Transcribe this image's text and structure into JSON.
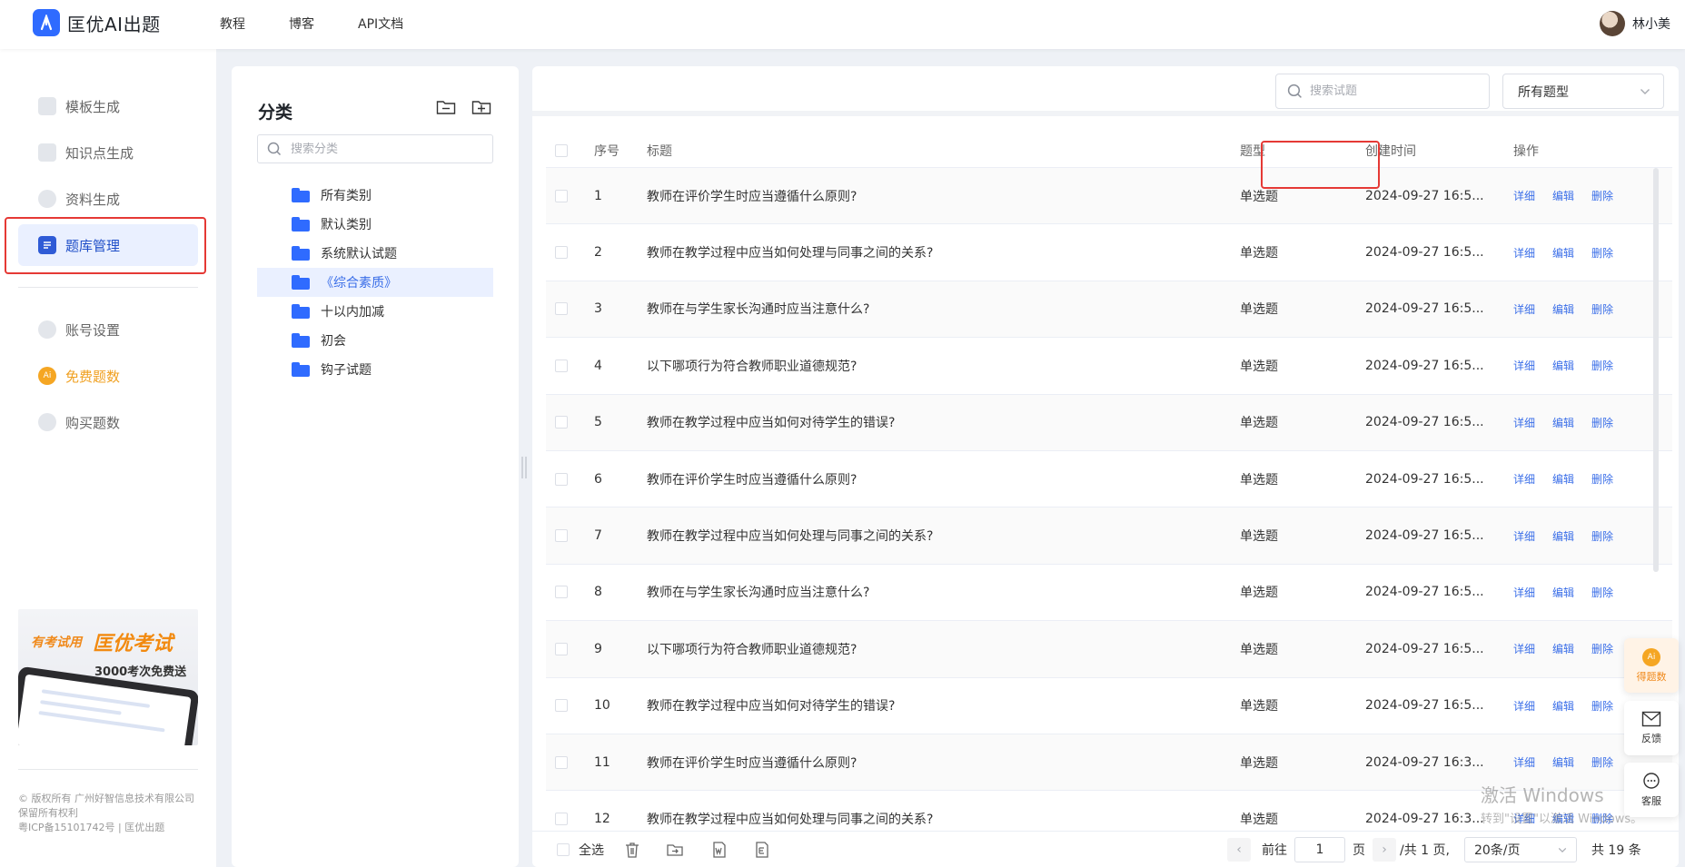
{
  "app": {
    "name": "匡优AI出题"
  },
  "topnav": [
    {
      "label": "教程"
    },
    {
      "label": "博客"
    },
    {
      "label": "API文档"
    }
  ],
  "user": {
    "name": "林小美"
  },
  "sidebar": {
    "items": [
      {
        "label": "模板生成"
      },
      {
        "label": "知识点生成"
      },
      {
        "label": "资料生成"
      },
      {
        "label": "题库管理"
      },
      {
        "label": "账号设置"
      },
      {
        "label": "免费题数"
      },
      {
        "label": "购买题数"
      }
    ],
    "free_icon_text": "Ai",
    "promo": {
      "tag": "有考试用",
      "brand": "匡优考试",
      "offer": "3000考次免费送"
    },
    "footer": {
      "line1": "© 版权所有 广州好智信息技术有限公司",
      "line2": "保留所有权利",
      "line3": "粤ICP备15101742号 | 匡优出题"
    }
  },
  "category": {
    "title": "分类",
    "search_placeholder": "搜索分类",
    "items": [
      {
        "label": "所有类别"
      },
      {
        "label": "默认类别"
      },
      {
        "label": "系统默认试题"
      },
      {
        "label": "《综合素质》"
      },
      {
        "label": "十以内加减"
      },
      {
        "label": "初会"
      },
      {
        "label": "钩子试题"
      }
    ],
    "active_index": 3
  },
  "main": {
    "search_placeholder": "搜索试题",
    "type_filter": "所有题型",
    "columns": {
      "no": "序号",
      "title": "标题",
      "type": "题型",
      "time": "创建时间",
      "ops": "操作"
    },
    "ops": {
      "detail": "详细",
      "edit": "编辑",
      "delete": "删除"
    },
    "rows": [
      {
        "no": "1",
        "title": "教师在评价学生时应当遵循什么原则?",
        "type": "单选题",
        "time": "2024-09-27 16:5..."
      },
      {
        "no": "2",
        "title": "教师在教学过程中应当如何处理与同事之间的关系?",
        "type": "单选题",
        "time": "2024-09-27 16:5..."
      },
      {
        "no": "3",
        "title": "教师在与学生家长沟通时应当注意什么?",
        "type": "单选题",
        "time": "2024-09-27 16:5..."
      },
      {
        "no": "4",
        "title": "以下哪项行为符合教师职业道德规范?",
        "type": "单选题",
        "time": "2024-09-27 16:5..."
      },
      {
        "no": "5",
        "title": "教师在教学过程中应当如何对待学生的错误?",
        "type": "单选题",
        "time": "2024-09-27 16:5..."
      },
      {
        "no": "6",
        "title": "教师在评价学生时应当遵循什么原则?",
        "type": "单选题",
        "time": "2024-09-27 16:5..."
      },
      {
        "no": "7",
        "title": "教师在教学过程中应当如何处理与同事之间的关系?",
        "type": "单选题",
        "time": "2024-09-27 16:5..."
      },
      {
        "no": "8",
        "title": "教师在与学生家长沟通时应当注意什么?",
        "type": "单选题",
        "time": "2024-09-27 16:5..."
      },
      {
        "no": "9",
        "title": "以下哪项行为符合教师职业道德规范?",
        "type": "单选题",
        "time": "2024-09-27 16:5..."
      },
      {
        "no": "10",
        "title": "教师在教学过程中应当如何对待学生的错误?",
        "type": "单选题",
        "time": "2024-09-27 16:5..."
      },
      {
        "no": "11",
        "title": "教师在评价学生时应当遵循什么原则?",
        "type": "单选题",
        "time": "2024-09-27 16:3..."
      },
      {
        "no": "12",
        "title": "教师在教学过程中应当如何处理与同事之间的关系?",
        "type": "单选题",
        "time": "2024-09-27 16:3..."
      }
    ],
    "footer": {
      "select_all": "全选",
      "goto": "前往",
      "page_value": "1",
      "page_unit": "页",
      "total_pages": "/共 1 页,",
      "page_size": "20条/页",
      "total": "共 19 条"
    }
  },
  "float": {
    "points": {
      "label": "得题数",
      "icon_text": "Ai"
    },
    "feedback": {
      "label": "反馈"
    },
    "service": {
      "label": "客服"
    }
  },
  "watermark": {
    "line1": "激活 Windows",
    "line2": "转到\"设置\"以激活 Windows。"
  },
  "colors": {
    "primary": "#2f6bff",
    "link": "#3a6ee8",
    "highlight_box": "#e53935",
    "free": "#f0a020"
  }
}
